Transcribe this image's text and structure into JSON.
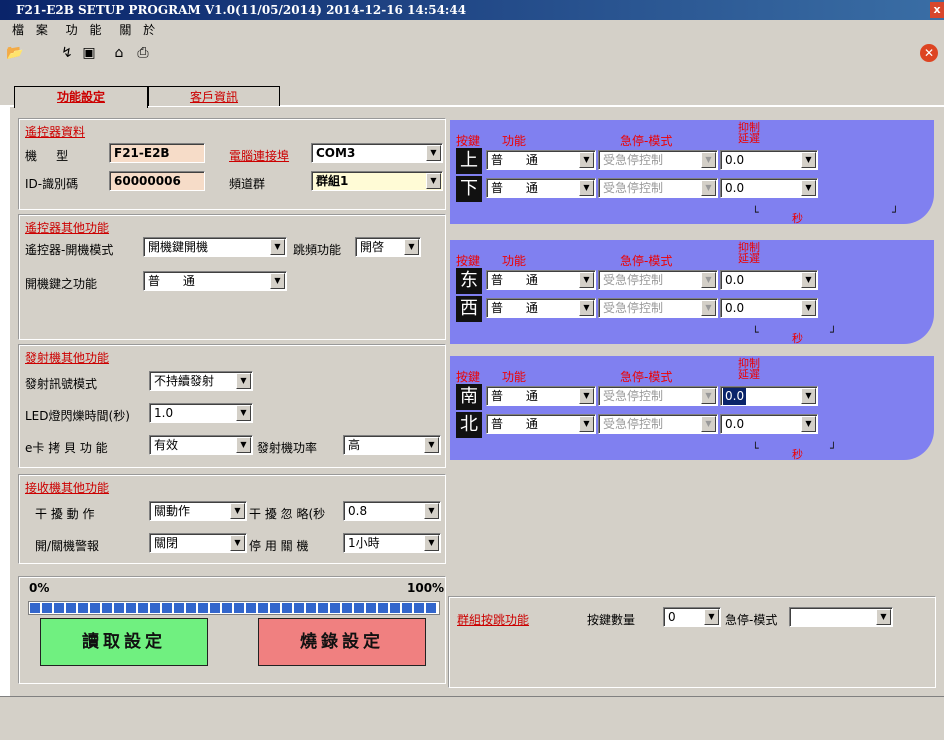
{
  "window": {
    "title": "F21-E2B SETUP PROGRAM V1.0(11/05/2014)  2014-12-16  14:54:44",
    "close": "x"
  },
  "menu": [
    "檔 案",
    "功 能",
    "關 於"
  ],
  "tabs": {
    "settings": "功能設定",
    "customer": "客戶資訊"
  },
  "remote": {
    "title": "遙控器資料",
    "model_label": "機     型",
    "model_value": "F21-E2B",
    "id_label": "ID-識別碼",
    "id_value": "60000006",
    "port_label": "電腦連接埠",
    "port_value": "COM3",
    "channel_label": "頻道群",
    "channel_value": "群組1"
  },
  "remote_other": {
    "title": "遙控器其他功能",
    "power_mode_label": "遙控器-開機模式",
    "power_mode_value": "開機鍵開機",
    "hop_label": "跳頻功能",
    "hop_value": "開啓",
    "power_key_label": "開機鍵之功能",
    "power_key_value": "普      通"
  },
  "transmitter": {
    "title": "發射機其他功能",
    "signal_label": "發射訊號模式",
    "signal_value": "不持續發射",
    "led_label": "LED燈閃爍時間(秒)",
    "led_value": "1.0",
    "ecard_label": "e卡 拷 貝 功 能",
    "ecard_value": "有效",
    "power_label": "發射機功率",
    "power_value": "高"
  },
  "receiver": {
    "title": "接收機其他功能",
    "interfere_label": "干 擾 動 作",
    "interfere_value": "關動作",
    "ignore_label": "干 擾 忽 略(秒",
    "ignore_value": "0.8",
    "alarm_label": "開/關機警報",
    "alarm_value": "關閉",
    "disable_label": "停 用 關 機",
    "disable_value": "1小時"
  },
  "progress": {
    "min_label": "0%",
    "max_label": "100%",
    "value": 1.0
  },
  "buttons": {
    "read": "讀取設定",
    "write": "燒錄設定"
  },
  "key_headers": {
    "key": "按鍵",
    "function": "功能",
    "estop": "急停-模式",
    "inhibit": "抑制",
    "delay": "延遲"
  },
  "key_groups": [
    {
      "rows": [
        {
          "dir": "上",
          "func": "普      通",
          "estop": "受急停控制",
          "delay": "0.0",
          "highlight": false
        },
        {
          "dir": "下",
          "func": "普      通",
          "estop": "受急停控制",
          "delay": "0.0",
          "highlight": false
        }
      ]
    },
    {
      "rows": [
        {
          "dir": "东",
          "func": "普      通",
          "estop": "受急停控制",
          "delay": "0.0",
          "highlight": false
        },
        {
          "dir": "西",
          "func": "普      通",
          "estop": "受急停控制",
          "delay": "0.0",
          "highlight": false
        }
      ]
    },
    {
      "rows": [
        {
          "dir": "南",
          "func": "普      通",
          "estop": "受急停控制",
          "delay": "0.0",
          "highlight": true
        },
        {
          "dir": "北",
          "func": "普      通",
          "estop": "受急停控制",
          "delay": "0.0",
          "highlight": false
        }
      ]
    }
  ],
  "bracket": {
    "left": "└",
    "unit": "秒",
    "right": "┘"
  },
  "group_jump": {
    "title": "群組按跳功能",
    "count_label": "按鍵數量",
    "count_value": "0",
    "estop_label": "急停-模式",
    "estop_value": ""
  }
}
